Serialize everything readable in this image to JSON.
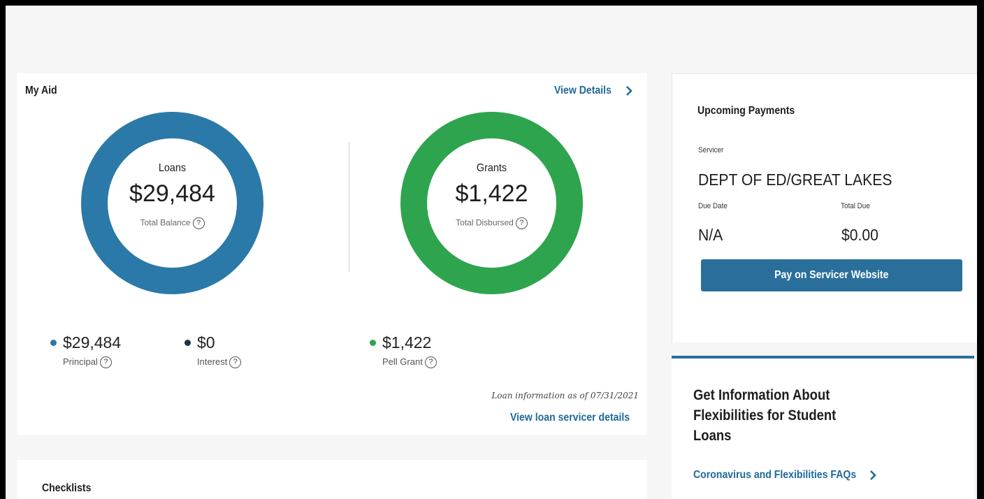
{
  "my_aid": {
    "title": "My Aid",
    "view_details": "View Details",
    "loans": {
      "label": "Loans",
      "value": "$29,484",
      "sub": "Total Balance",
      "color": "#2a79a8"
    },
    "grants": {
      "label": "Grants",
      "value": "$1,422",
      "sub": "Total Disbursed",
      "color": "#2ea44f"
    },
    "legend": [
      {
        "value": "$29,484",
        "label": "Principal",
        "color": "#2a79a8"
      },
      {
        "value": "$0",
        "label": "Interest",
        "color": "#1f3444"
      },
      {
        "value": "$1,422",
        "label": "Pell Grant",
        "color": "#2ea44f"
      }
    ],
    "as_of": "Loan information as of 07/31/2021",
    "servicer_link": "View loan servicer details"
  },
  "payments": {
    "title": "Upcoming Payments",
    "servicer_label": "Servicer",
    "servicer_name": "DEPT OF ED/GREAT LAKES",
    "due_date_label": "Due Date",
    "total_due_label": "Total Due",
    "due_date": "N/A",
    "total_due": "$0.00",
    "button": "Pay on Servicer Website"
  },
  "info": {
    "title": "Get Information About Flexibilities for Student Loans",
    "link": "Coronavirus and Flexibilities FAQs"
  },
  "checklists": {
    "title": "Checklists"
  },
  "help_glyph": "?"
}
